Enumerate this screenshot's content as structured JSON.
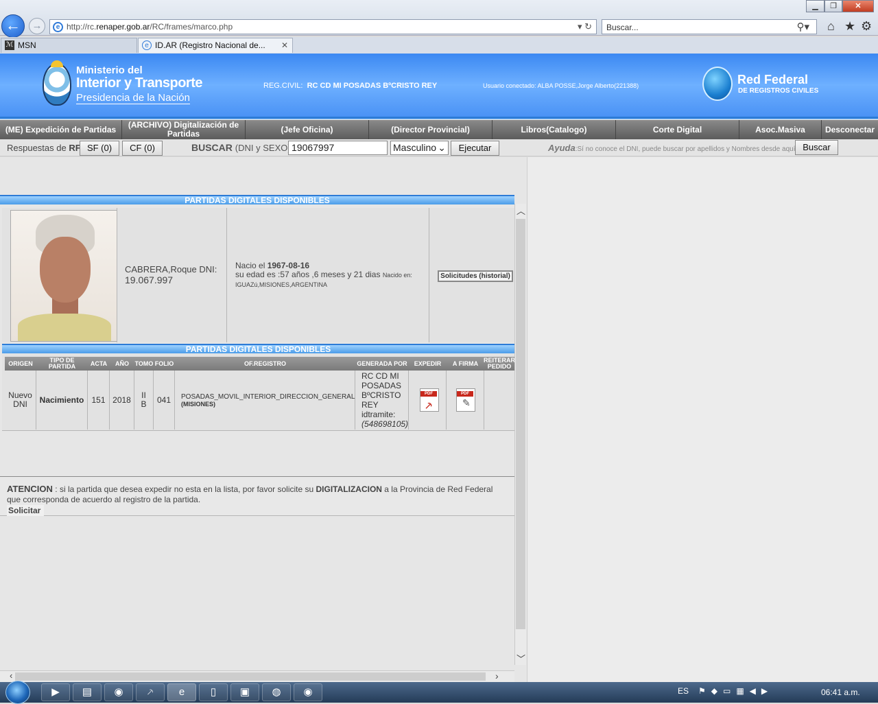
{
  "browser": {
    "url_prefix": "http://rc.",
    "url_domain": "renaper.gob.ar",
    "url_path": "/RC/frames/marco.php",
    "search_placeholder": "Buscar...",
    "tabs": [
      {
        "label": "MSN"
      },
      {
        "label": "ID.AR (Registro Nacional de..."
      }
    ]
  },
  "header": {
    "ministry_line1": "Ministerio del",
    "ministry_line2": "Interior y Transporte",
    "ministry_line3": "Presidencia de la Nación",
    "reg_civil_label": "REG.CIVIL:",
    "reg_civil_value": "RC CD MI POSADAS BºCRISTO REY",
    "usuario": "Usuario conectado: ALBA POSSE,Jorge Alberto(221388)",
    "red_title": "Red Federal",
    "red_sub": "DE REGISTROS CIVILES"
  },
  "nav": [
    "(ME) Expedición de Partidas",
    "(ARCHIVO) Digitalización de Partidas",
    "(Jefe Oficina)",
    "(Director Provincial)",
    "Libros(Catalogo)",
    "Corte Digital",
    "Asoc.Masiva",
    "Desconectar"
  ],
  "search_row": {
    "respuestas_label": "Respuestas de",
    "rf": "RF",
    "sf_button": "SF (0)",
    "cf_button": "CF (0)",
    "buscar_label": "BUSCAR",
    "buscar_hint": "(DNI y SEXO)",
    "dni_value": "19067997",
    "sexo_value": "Masculino",
    "ejecutar_button": "Ejecutar",
    "ayuda_label": "Ayuda",
    "ayuda_text": ":Sí no conoce el DNI, puede buscar por apellidos y Nombres desde aquí",
    "buscar_button": "Buscar"
  },
  "person": {
    "section_title": "PARTIDAS DIGITALES DISPONIBLES",
    "name_line": "CABRERA,Roque DNI:",
    "dni": "19.067.997",
    "nacio_label": "Nacio el",
    "birth_date": "1967-08-16",
    "edad_line": "su edad es :57 años ,6 meses y 21 dias",
    "nacido_en_label": "Nacido en:",
    "birth_place": "IGUAZú,MISIONES,ARGENTINA",
    "solicitudes_button": "Solicitudes (historial)"
  },
  "partidas": {
    "section_title": "PARTIDAS DIGITALES DISPONIBLES",
    "columns": [
      "ORIGEN",
      "TIPO DE PARTIDA",
      "ACTA",
      "AÑO",
      "TOMO",
      "FOLIO",
      "OF.REGISTRO",
      "GENERADA POR",
      "EXPEDIR",
      "A FIRMA",
      "REITERAR PEDIDO"
    ],
    "rows": [
      {
        "origen": "Nuevo DNI",
        "tipo": "Nacimiento",
        "acta": "151",
        "anio": "2018",
        "tomo": "II B",
        "folio": "041",
        "of_registro": "POSADAS_MOVIL_INTERIOR_DIRECCION_GENERAL",
        "of_registro_prov": "(MISIONES)",
        "generada_por": "RC CD MI POSADAS BºCRISTO REY idtramite:",
        "idtramite": "(548698105)"
      }
    ]
  },
  "attention": {
    "title": "ATENCION",
    "text_part1": ": si la partida que desea expedir no esta en la lista, por favor solicite su",
    "keyword": "DIGITALIZACION",
    "text_part2": "a la Provincia de Red Federal que corresponda de acuerdo al registro de la partida.",
    "solicitar_button": "Solicitar"
  },
  "taskbar": {
    "lang": "ES",
    "time": "06:41 a.m."
  }
}
